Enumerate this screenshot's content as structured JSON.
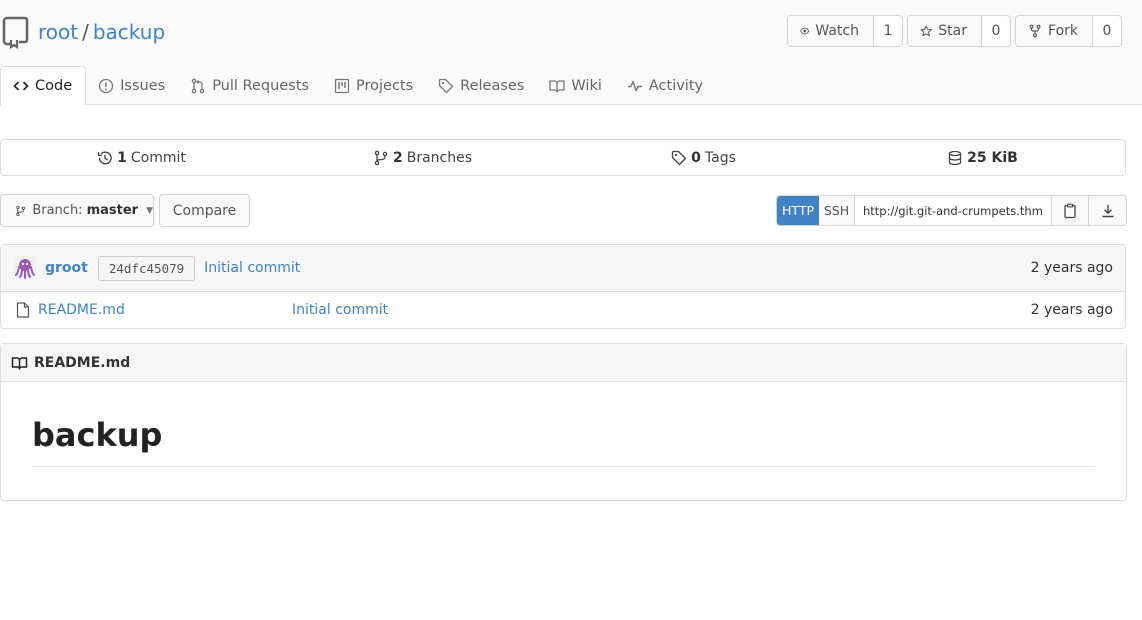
{
  "repo": {
    "owner": "root",
    "separator": "/",
    "name": "backup"
  },
  "actions": {
    "watch": {
      "label": "Watch",
      "count": "1"
    },
    "star": {
      "label": "Star",
      "count": "0"
    },
    "fork": {
      "label": "Fork",
      "count": "0"
    }
  },
  "tabs": [
    {
      "label": "Code",
      "icon": "code-icon",
      "active": true
    },
    {
      "label": "Issues",
      "icon": "issue-icon"
    },
    {
      "label": "Pull Requests",
      "icon": "pull-request-icon"
    },
    {
      "label": "Projects",
      "icon": "project-icon"
    },
    {
      "label": "Releases",
      "icon": "tag-icon"
    },
    {
      "label": "Wiki",
      "icon": "book-icon"
    },
    {
      "label": "Activity",
      "icon": "pulse-icon"
    }
  ],
  "stats": {
    "commits": {
      "count": "1",
      "label": "Commit"
    },
    "branches": {
      "count": "2",
      "label": "Branches"
    },
    "tags": {
      "count": "0",
      "label": "Tags"
    },
    "size": {
      "count": "25 KiB"
    }
  },
  "branch": {
    "prefix": "Branch:",
    "name": "master"
  },
  "compare_label": "Compare",
  "clone": {
    "http_label": "HTTP",
    "ssh_label": "SSH",
    "url": "http://git.git-and-crumpets.thm/root/backup.git"
  },
  "latest_commit": {
    "author": "groot",
    "sha": "24dfc45079",
    "message": "Initial commit",
    "time": "2 years ago"
  },
  "files": [
    {
      "name": "README.md",
      "message": "Initial commit",
      "time": "2 years ago"
    }
  ],
  "readme": {
    "filename": "README.md",
    "heading": "backup"
  },
  "colors": {
    "link": "#4183c4",
    "accent": "#4183c4",
    "border": "#dedede"
  }
}
